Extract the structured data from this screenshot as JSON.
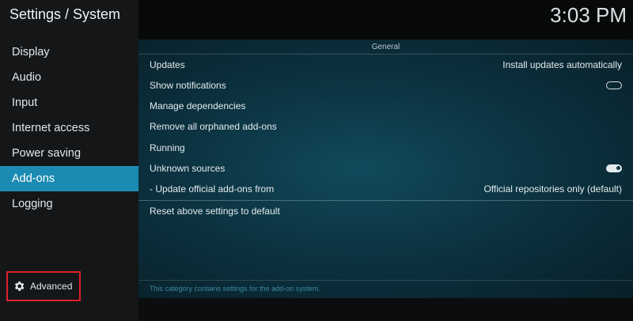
{
  "header": {
    "title": "Settings / System",
    "clock": "3:03 PM"
  },
  "sidebar": {
    "items": [
      {
        "label": "Display"
      },
      {
        "label": "Audio"
      },
      {
        "label": "Input"
      },
      {
        "label": "Internet access"
      },
      {
        "label": "Power saving"
      },
      {
        "label": "Add-ons",
        "active": true
      },
      {
        "label": "Logging"
      }
    ],
    "advanced_label": "Advanced",
    "advanced_icon": "gear-icon"
  },
  "main": {
    "section_title": "General",
    "settings": [
      {
        "label": "Updates",
        "value": "Install updates automatically"
      },
      {
        "label": "Show notifications",
        "toggle": "off"
      },
      {
        "label": "Manage dependencies"
      },
      {
        "label": "Remove all orphaned add-ons"
      },
      {
        "label": "Running"
      },
      {
        "label": "Unknown sources",
        "toggle": "on"
      },
      {
        "label": "- Update official add-ons from",
        "value": "Official repositories only (default)"
      }
    ],
    "reset_label": "Reset above settings to default",
    "description": "This category contains settings for the add-on system."
  },
  "colors": {
    "accent": "#1b8bb3",
    "highlight_box": "#e0202a"
  }
}
